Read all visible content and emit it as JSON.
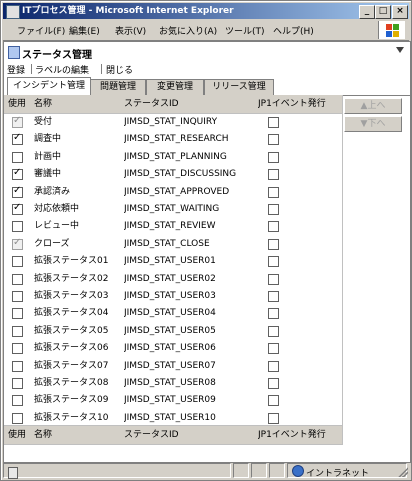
{
  "window": {
    "title": "ITプロセス管理 - Microsoft Internet Explorer",
    "min": "_",
    "max": "□",
    "close": "×"
  },
  "menu": [
    "ファイル(F)",
    "編集(E)",
    "表示(V)",
    "お気に入り(A)",
    "ツール(T)",
    "ヘルプ(H)"
  ],
  "panel": {
    "title": "ステータス管理"
  },
  "toolbar": {
    "register": "登録",
    "edit_label": "ラベルの編集",
    "close": "閉じる"
  },
  "tabs": [
    {
      "label": "インシデント管理",
      "active": true
    },
    {
      "label": "問題管理",
      "active": false
    },
    {
      "label": "変更管理",
      "active": false
    },
    {
      "label": "リリース管理",
      "active": false
    }
  ],
  "columns": {
    "use": "使用",
    "name": "名称",
    "status_id": "ステータスID",
    "jp1": "JP1イベント発行"
  },
  "rows": [
    {
      "use": true,
      "use_disabled": true,
      "name": "受付",
      "status_id": "JIMSD_STAT_INQUIRY",
      "jp1": false
    },
    {
      "use": true,
      "use_disabled": false,
      "name": "調査中",
      "status_id": "JIMSD_STAT_RESEARCH",
      "jp1": false
    },
    {
      "use": false,
      "use_disabled": false,
      "name": "計画中",
      "status_id": "JIMSD_STAT_PLANNING",
      "jp1": false
    },
    {
      "use": true,
      "use_disabled": false,
      "name": "審議中",
      "status_id": "JIMSD_STAT_DISCUSSING",
      "jp1": false
    },
    {
      "use": true,
      "use_disabled": false,
      "name": "承認済み",
      "status_id": "JIMSD_STAT_APPROVED",
      "jp1": false
    },
    {
      "use": true,
      "use_disabled": false,
      "name": "対応依頼中",
      "status_id": "JIMSD_STAT_WAITING",
      "jp1": false
    },
    {
      "use": false,
      "use_disabled": false,
      "name": "レビュー中",
      "status_id": "JIMSD_STAT_REVIEW",
      "jp1": false
    },
    {
      "use": true,
      "use_disabled": true,
      "name": "クローズ",
      "status_id": "JIMSD_STAT_CLOSE",
      "jp1": false
    },
    {
      "use": false,
      "use_disabled": false,
      "name": "拡張ステータス01",
      "status_id": "JIMSD_STAT_USER01",
      "jp1": false
    },
    {
      "use": false,
      "use_disabled": false,
      "name": "拡張ステータス02",
      "status_id": "JIMSD_STAT_USER02",
      "jp1": false
    },
    {
      "use": false,
      "use_disabled": false,
      "name": "拡張ステータス03",
      "status_id": "JIMSD_STAT_USER03",
      "jp1": false
    },
    {
      "use": false,
      "use_disabled": false,
      "name": "拡張ステータス04",
      "status_id": "JIMSD_STAT_USER04",
      "jp1": false
    },
    {
      "use": false,
      "use_disabled": false,
      "name": "拡張ステータス05",
      "status_id": "JIMSD_STAT_USER05",
      "jp1": false
    },
    {
      "use": false,
      "use_disabled": false,
      "name": "拡張ステータス06",
      "status_id": "JIMSD_STAT_USER06",
      "jp1": false
    },
    {
      "use": false,
      "use_disabled": false,
      "name": "拡張ステータス07",
      "status_id": "JIMSD_STAT_USER07",
      "jp1": false
    },
    {
      "use": false,
      "use_disabled": false,
      "name": "拡張ステータス08",
      "status_id": "JIMSD_STAT_USER08",
      "jp1": false
    },
    {
      "use": false,
      "use_disabled": false,
      "name": "拡張ステータス09",
      "status_id": "JIMSD_STAT_USER09",
      "jp1": false
    },
    {
      "use": false,
      "use_disabled": false,
      "name": "拡張ステータス10",
      "status_id": "JIMSD_STAT_USER10",
      "jp1": false
    }
  ],
  "side": {
    "up": "▲上へ",
    "down": "▼下へ"
  },
  "status": {
    "zone": "イントラネット"
  },
  "icons": [
    "ie-page-icon",
    "panel-icon",
    "collapse-arrow-icon",
    "windows-logo-icon",
    "globe-icon"
  ]
}
